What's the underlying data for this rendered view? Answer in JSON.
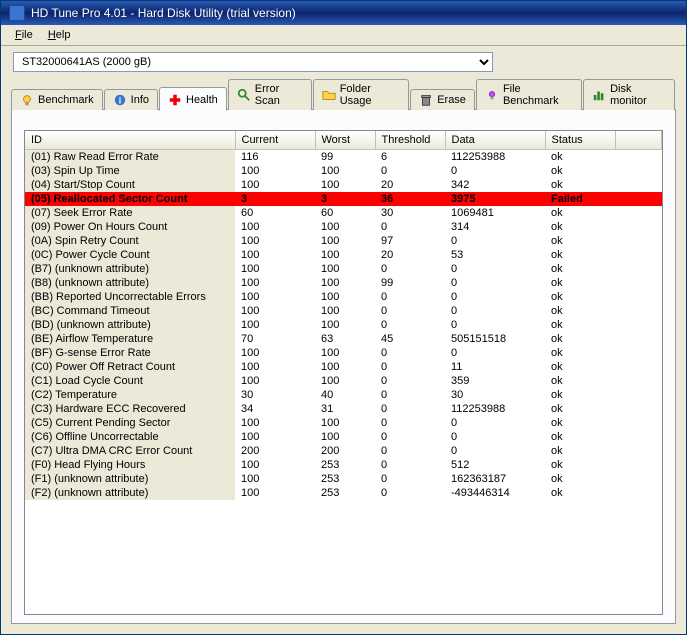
{
  "window": {
    "title": "HD Tune Pro 4.01 - Hard Disk Utility (trial version)"
  },
  "menu": {
    "file": "File",
    "help": "Help"
  },
  "device": {
    "selected": "ST32000641AS (2000 gB)"
  },
  "tabs": [
    {
      "label": "Benchmark"
    },
    {
      "label": "Info"
    },
    {
      "label": "Health"
    },
    {
      "label": "Error Scan"
    },
    {
      "label": "Folder Usage"
    },
    {
      "label": "Erase"
    },
    {
      "label": "File Benchmark"
    },
    {
      "label": "Disk monitor"
    }
  ],
  "columns": {
    "id": "ID",
    "current": "Current",
    "worst": "Worst",
    "threshold": "Threshold",
    "data": "Data",
    "status": "Status"
  },
  "chart_data": {
    "type": "table",
    "title": "SMART Health Attributes",
    "rows": [
      {
        "id": "(01) Raw Read Error Rate",
        "current": 116,
        "worst": 99,
        "threshold": 6,
        "data": "112253988",
        "status": "ok",
        "failed": false
      },
      {
        "id": "(03) Spin Up Time",
        "current": 100,
        "worst": 100,
        "threshold": 0,
        "data": "0",
        "status": "ok",
        "failed": false
      },
      {
        "id": "(04) Start/Stop Count",
        "current": 100,
        "worst": 100,
        "threshold": 20,
        "data": "342",
        "status": "ok",
        "failed": false
      },
      {
        "id": "(05) Reallocated Sector Count",
        "current": 3,
        "worst": 3,
        "threshold": 36,
        "data": "3975",
        "status": "Failed",
        "failed": true
      },
      {
        "id": "(07) Seek Error Rate",
        "current": 60,
        "worst": 60,
        "threshold": 30,
        "data": "1069481",
        "status": "ok",
        "failed": false
      },
      {
        "id": "(09) Power On Hours Count",
        "current": 100,
        "worst": 100,
        "threshold": 0,
        "data": "314",
        "status": "ok",
        "failed": false
      },
      {
        "id": "(0A) Spin Retry Count",
        "current": 100,
        "worst": 100,
        "threshold": 97,
        "data": "0",
        "status": "ok",
        "failed": false
      },
      {
        "id": "(0C) Power Cycle Count",
        "current": 100,
        "worst": 100,
        "threshold": 20,
        "data": "53",
        "status": "ok",
        "failed": false
      },
      {
        "id": "(B7) (unknown attribute)",
        "current": 100,
        "worst": 100,
        "threshold": 0,
        "data": "0",
        "status": "ok",
        "failed": false
      },
      {
        "id": "(B8) (unknown attribute)",
        "current": 100,
        "worst": 100,
        "threshold": 99,
        "data": "0",
        "status": "ok",
        "failed": false
      },
      {
        "id": "(BB) Reported Uncorrectable Errors",
        "current": 100,
        "worst": 100,
        "threshold": 0,
        "data": "0",
        "status": "ok",
        "failed": false
      },
      {
        "id": "(BC) Command Timeout",
        "current": 100,
        "worst": 100,
        "threshold": 0,
        "data": "0",
        "status": "ok",
        "failed": false
      },
      {
        "id": "(BD) (unknown attribute)",
        "current": 100,
        "worst": 100,
        "threshold": 0,
        "data": "0",
        "status": "ok",
        "failed": false
      },
      {
        "id": "(BE) Airflow Temperature",
        "current": 70,
        "worst": 63,
        "threshold": 45,
        "data": "505151518",
        "status": "ok",
        "failed": false
      },
      {
        "id": "(BF) G-sense Error Rate",
        "current": 100,
        "worst": 100,
        "threshold": 0,
        "data": "0",
        "status": "ok",
        "failed": false
      },
      {
        "id": "(C0) Power Off Retract Count",
        "current": 100,
        "worst": 100,
        "threshold": 0,
        "data": "11",
        "status": "ok",
        "failed": false
      },
      {
        "id": "(C1) Load Cycle Count",
        "current": 100,
        "worst": 100,
        "threshold": 0,
        "data": "359",
        "status": "ok",
        "failed": false
      },
      {
        "id": "(C2) Temperature",
        "current": 30,
        "worst": 40,
        "threshold": 0,
        "data": "30",
        "status": "ok",
        "failed": false
      },
      {
        "id": "(C3) Hardware ECC Recovered",
        "current": 34,
        "worst": 31,
        "threshold": 0,
        "data": "112253988",
        "status": "ok",
        "failed": false
      },
      {
        "id": "(C5) Current Pending Sector",
        "current": 100,
        "worst": 100,
        "threshold": 0,
        "data": "0",
        "status": "ok",
        "failed": false
      },
      {
        "id": "(C6) Offline Uncorrectable",
        "current": 100,
        "worst": 100,
        "threshold": 0,
        "data": "0",
        "status": "ok",
        "failed": false
      },
      {
        "id": "(C7) Ultra DMA CRC Error Count",
        "current": 200,
        "worst": 200,
        "threshold": 0,
        "data": "0",
        "status": "ok",
        "failed": false
      },
      {
        "id": "(F0) Head Flying Hours",
        "current": 100,
        "worst": 253,
        "threshold": 0,
        "data": "512",
        "status": "ok",
        "failed": false
      },
      {
        "id": "(F1) (unknown attribute)",
        "current": 100,
        "worst": 253,
        "threshold": 0,
        "data": "162363187",
        "status": "ok",
        "failed": false
      },
      {
        "id": "(F2) (unknown attribute)",
        "current": 100,
        "worst": 253,
        "threshold": 0,
        "data": "-493446314",
        "status": "ok",
        "failed": false
      }
    ]
  }
}
